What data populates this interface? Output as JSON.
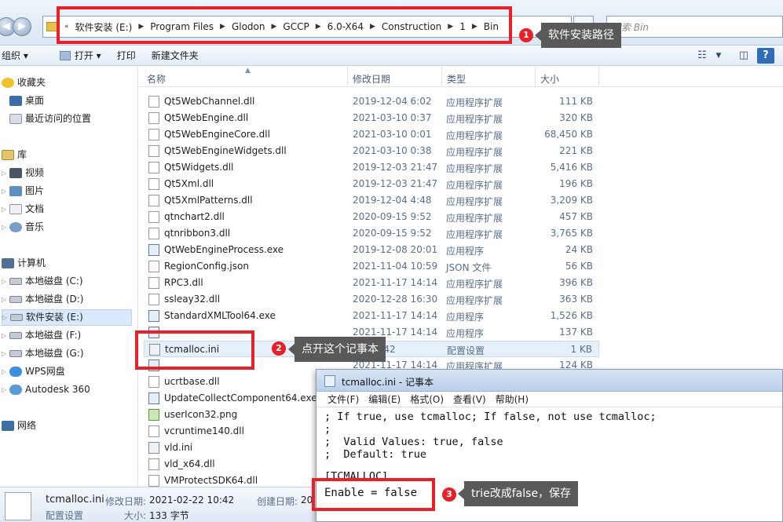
{
  "address": {
    "crumbs": [
      "软件安装 (E:)",
      "Program Files",
      "Glodon",
      "GCCP",
      "6.0-X64",
      "Construction",
      "1",
      "Bin"
    ],
    "search_placeholder": "搜索 Bin"
  },
  "toolbar": {
    "organize": "组织 ▾",
    "open": "打开 ▾",
    "print": "打印",
    "new_folder": "新建文件夹"
  },
  "sidebar": {
    "favorites": "收藏夹",
    "desktop": "桌面",
    "recent": "最近访问的位置",
    "libraries": "库",
    "videos": "视频",
    "pictures": "图片",
    "documents": "文档",
    "music": "音乐",
    "computer": "计算机",
    "drive_c": "本地磁盘 (C:)",
    "drive_d": "本地磁盘 (D:)",
    "drive_e": "软件安装 (E:)",
    "drive_f": "本地磁盘 (F:)",
    "drive_g": "本地磁盘 (G:)",
    "wps": "WPS网盘",
    "autodesk": "Autodesk 360",
    "network": "网络"
  },
  "columns": {
    "name": "名称",
    "date": "修改日期",
    "type": "类型",
    "size": "大小"
  },
  "files": [
    {
      "name": "Qt5WebChannel.dll",
      "date": "2019-12-04 6:02",
      "type": "应用程序扩展",
      "size": "111 KB",
      "kind": "dll"
    },
    {
      "name": "Qt5WebEngine.dll",
      "date": "2021-03-10 0:37",
      "type": "应用程序扩展",
      "size": "320 KB",
      "kind": "dll"
    },
    {
      "name": "Qt5WebEngineCore.dll",
      "date": "2021-03-10 0:01",
      "type": "应用程序扩展",
      "size": "68,450 KB",
      "kind": "dll"
    },
    {
      "name": "Qt5WebEngineWidgets.dll",
      "date": "2021-03-10 0:38",
      "type": "应用程序扩展",
      "size": "221 KB",
      "kind": "dll"
    },
    {
      "name": "Qt5Widgets.dll",
      "date": "2019-12-03 21:47",
      "type": "应用程序扩展",
      "size": "5,416 KB",
      "kind": "dll"
    },
    {
      "name": "Qt5Xml.dll",
      "date": "2019-12-03 21:47",
      "type": "应用程序扩展",
      "size": "196 KB",
      "kind": "dll"
    },
    {
      "name": "Qt5XmlPatterns.dll",
      "date": "2019-12-04 4:48",
      "type": "应用程序扩展",
      "size": "3,209 KB",
      "kind": "dll"
    },
    {
      "name": "qtnchart2.dll",
      "date": "2020-09-15 9:52",
      "type": "应用程序扩展",
      "size": "457 KB",
      "kind": "dll"
    },
    {
      "name": "qtnribbon3.dll",
      "date": "2020-09-15 9:52",
      "type": "应用程序扩展",
      "size": "3,765 KB",
      "kind": "dll"
    },
    {
      "name": "QtWebEngineProcess.exe",
      "date": "2019-12-08 20:01",
      "type": "应用程序",
      "size": "24 KB",
      "kind": "exe"
    },
    {
      "name": "RegionConfig.json",
      "date": "2021-11-04 10:59",
      "type": "JSON 文件",
      "size": "56 KB",
      "kind": "json"
    },
    {
      "name": "RPC3.dll",
      "date": "2021-11-17 14:14",
      "type": "应用程序扩展",
      "size": "396 KB",
      "kind": "dll"
    },
    {
      "name": "ssleay32.dll",
      "date": "2020-12-28 16:30",
      "type": "应用程序扩展",
      "size": "363 KB",
      "kind": "dll"
    },
    {
      "name": "StandardXMLTool64.exe",
      "date": "2021-11-17 14:14",
      "type": "应用程序",
      "size": "1,526 KB",
      "kind": "exe"
    },
    {
      "name": "",
      "date": "2021-11-17 14:14",
      "type": "应用程序",
      "size": "137 KB",
      "kind": "exe"
    },
    {
      "name": "tcmalloc.ini",
      "date": "22 10:42",
      "type": "配置设置",
      "size": "1 KB",
      "kind": "cfg"
    },
    {
      "name": "",
      "date": "2021-11-17 14:14",
      "type": "应用程序扩展",
      "size": "124 KB",
      "kind": "exe"
    },
    {
      "name": "ucrtbase.dll",
      "date": "",
      "type": "",
      "size": "",
      "kind": "dll"
    },
    {
      "name": "UpdateCollectComponent64.exe",
      "date": "",
      "type": "",
      "size": "",
      "kind": "exe"
    },
    {
      "name": "userIcon32.png",
      "date": "",
      "type": "",
      "size": "",
      "kind": "png"
    },
    {
      "name": "vcruntime140.dll",
      "date": "",
      "type": "",
      "size": "",
      "kind": "dll"
    },
    {
      "name": "vld.ini",
      "date": "",
      "type": "",
      "size": "",
      "kind": "cfg"
    },
    {
      "name": "vld_x64.dll",
      "date": "",
      "type": "",
      "size": "",
      "kind": "dll"
    },
    {
      "name": "VMProtectSDK64.dll",
      "date": "",
      "type": "",
      "size": "",
      "kind": "dll"
    }
  ],
  "details": {
    "name": "tcmalloc.ini",
    "modified_label": "修改日期:",
    "modified": "2021-02-22 10:42",
    "created_label": "创建日期:",
    "created": "20",
    "type": "配置设置",
    "size_label": "大小:",
    "size": "133 字节"
  },
  "notepad": {
    "title": "tcmalloc.ini - 记事本",
    "menu": [
      "文件(F)",
      "编辑(E)",
      "格式(O)",
      "查看(V)",
      "帮助(H)"
    ],
    "text": "; If true, use tcmalloc; If false, not use tcmalloc;\n;\n;  Valid Values: true, false\n;  Default: true",
    "section": "[TCMALLOC]",
    "enable_line": "Enable = false"
  },
  "annotations": {
    "badge1": "1",
    "callout1": "软件安装路径",
    "badge2": "2",
    "callout2": "点开这个记事本",
    "badge3": "3",
    "callout3": "trie改成false，保存"
  },
  "colors": {
    "highlight": "#e8202a",
    "callout_bg": "#595959"
  }
}
